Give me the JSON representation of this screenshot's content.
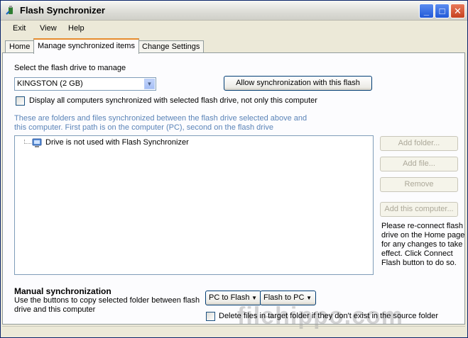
{
  "window": {
    "title": "Flash Synchronizer"
  },
  "menu": {
    "exit": "Exit",
    "view": "View",
    "help": "Help"
  },
  "tabs": {
    "home": "Home",
    "manage": "Manage synchronized items",
    "change": "Change Settings"
  },
  "manage": {
    "select_label": "Select the flash drive to manage",
    "drive_selected": "KINGSTON (2 GB)",
    "allow_button": "Allow synchronization with this flash",
    "display_all_label": "Display all computers synchronized with selected flash drive, not only this computer",
    "info_text": "These are folders and files synchronized between the flash drive selected above and this computer. First path is on the computer (PC), second on the flash drive",
    "tree_item": "Drive is not used with Flash Synchronizer",
    "add_folder": "Add folder...",
    "add_file": "Add file...",
    "remove": "Remove",
    "add_computer": "Add this computer...",
    "note": "Please re-connect flash drive on the Home page for any changes to take effect. Click Connect Flash button to do so.",
    "manual_title": "Manual synchronization",
    "manual_desc": "Use the buttons to copy selected folder between flash drive and this computer",
    "pc_to_flash": "PC to Flash",
    "flash_to_pc": "Flash to PC",
    "delete_label": "Delete files in target folder if they don't exist in the source folder"
  },
  "watermark": "filehippo.com",
  "colors": {
    "accent": "#0a246a",
    "info": "#5b84b8",
    "active_tab": "#e68b2c"
  }
}
